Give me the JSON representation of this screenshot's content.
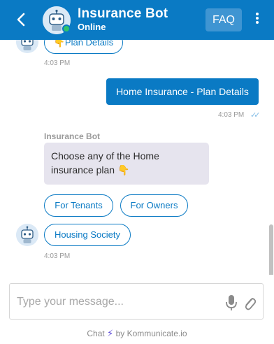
{
  "header": {
    "title": "Insurance Bot",
    "status": "Online",
    "faq_label": "FAQ"
  },
  "messages": {
    "top_chip": "Plan Details",
    "top_chip_emoji": "👇",
    "top_time": "4:03 PM",
    "user_message": "Home Insurance - Plan Details",
    "user_time": "4:03 PM",
    "read_ticks": "✓✓",
    "sender_name": "Insurance Bot",
    "bot_message": "Choose any of the Home insurance plan 👇",
    "chips": [
      "For Tenants",
      "For Owners",
      "Housing Society"
    ],
    "bottom_time": "4:03 PM"
  },
  "composer": {
    "placeholder": "Type your message..."
  },
  "footer": {
    "prefix": "Chat",
    "bolt": "⚡",
    "suffix": "by Kommunicate.io"
  },
  "colors": {
    "brand": "#0a7ac4",
    "online": "#31c46b",
    "bubble_bot": "#e6e4ee"
  },
  "icons": [
    "back-arrow-icon",
    "bot-avatar-icon",
    "kebab-menu-icon",
    "microphone-icon",
    "paperclip-icon",
    "lightning-icon",
    "double-check-icon"
  ]
}
